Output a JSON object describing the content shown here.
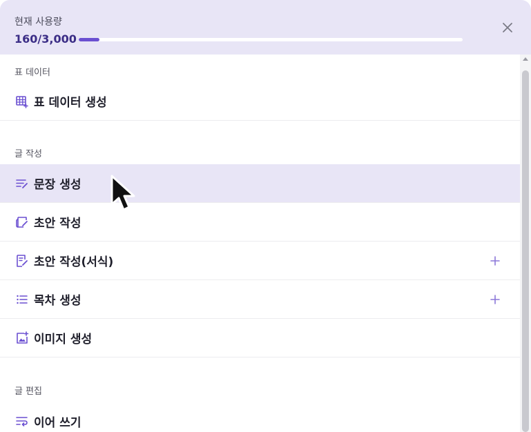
{
  "usage": {
    "label": "현재 사용량",
    "value": "160/3,000",
    "used": 160,
    "limit": 3000,
    "accent_color": "#6a4fd1"
  },
  "close": {
    "icon": "close-icon"
  },
  "sections": {
    "table": {
      "title": "표 데이터",
      "items": [
        {
          "label": "표 데이터 생성",
          "icon": "table-add-icon"
        }
      ]
    },
    "writing": {
      "title": "글 작성",
      "items": [
        {
          "label": "문장 생성",
          "icon": "sentence-edit-icon",
          "hovered": true
        },
        {
          "label": "초안 작성",
          "icon": "draft-icon"
        },
        {
          "label": "초안 작성(서식)",
          "icon": "draft-format-icon",
          "has_add": true
        },
        {
          "label": "목차 생성",
          "icon": "list-icon",
          "has_add": true
        },
        {
          "label": "이미지 생성",
          "icon": "image-add-icon"
        }
      ]
    },
    "editing": {
      "title": "글 편집",
      "items": [
        {
          "label": "이어 쓰기",
          "icon": "continue-writing-icon"
        }
      ]
    }
  }
}
